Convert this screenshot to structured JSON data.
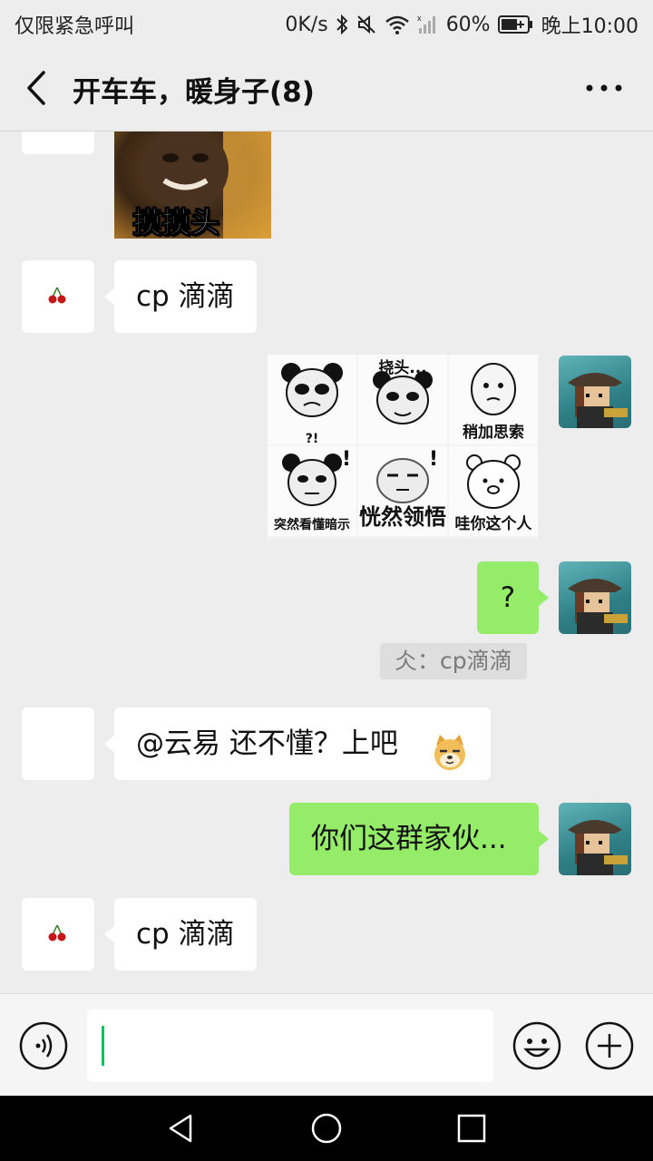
{
  "status_bar": {
    "carrier": "仅限紧急呼叫",
    "speed": "0K/s",
    "battery": "60%",
    "time": "晚上10:00"
  },
  "header": {
    "title": "开车车，暖身子(8)"
  },
  "messages": {
    "sticker_caption": "摸摸头",
    "m2_text": "cp 滴滴",
    "grid": {
      "c2": "挠头...",
      "c3": "稍加思索",
      "c4_mark": "?!",
      "c4": "突然看懂暗示",
      "c5": "恍然领悟",
      "c6": "哇你这个人",
      "c5_mark": "!",
      "c4_mark2": "!"
    },
    "m4_text": "?",
    "m4_quote": "仌：cp滴滴",
    "m5_text": "@云易  还不懂？上吧",
    "m6_text": "你们这群家伙...",
    "m7_text": "cp 滴滴"
  },
  "colors": {
    "background": "#ededed",
    "outgoing_bubble": "#95ec69",
    "incoming_bubble": "#ffffff",
    "caret": "#07c160"
  },
  "icons": {
    "back": "back-arrow-icon",
    "more": "more-dots-icon",
    "voice": "voice-icon",
    "emoji": "emoji-icon",
    "plus": "plus-icon"
  }
}
